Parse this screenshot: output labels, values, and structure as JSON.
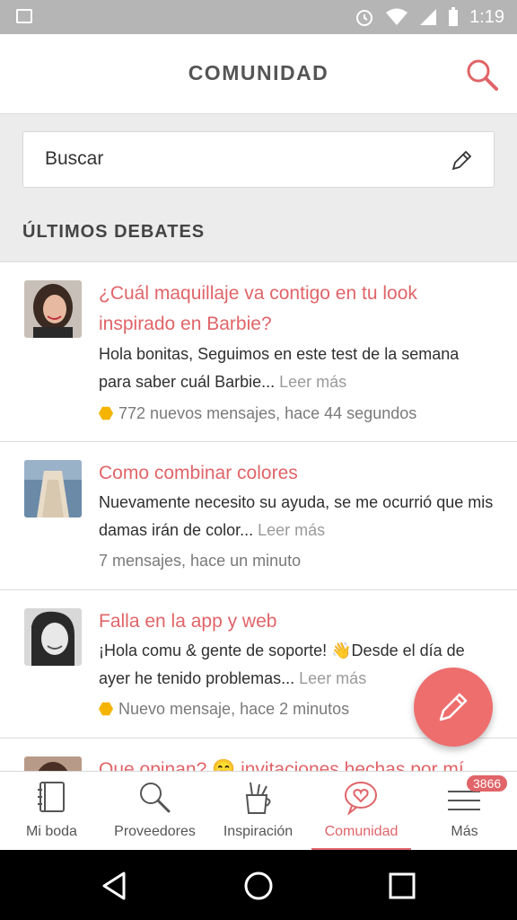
{
  "status_bar": {
    "time": "1:19"
  },
  "header": {
    "title": "COMUNIDAD"
  },
  "search": {
    "placeholder": "Buscar"
  },
  "section": {
    "title": "ÚLTIMOS DEBATES"
  },
  "debates": [
    {
      "title": "¿Cuál maquillaje va contigo en tu look inspirado en Barbie?",
      "excerpt": "Hola bonitas, Seguimos en este test de la semana para saber cuál Barbie...",
      "read_more": "Leer más",
      "meta": "772 nuevos mensajes, hace 44 segundos",
      "new_indicator": true
    },
    {
      "title": "Como combinar colores",
      "excerpt": "Nuevamente necesito su ayuda, se me ocurrió que mis damas irán de color...",
      "read_more": "Leer más",
      "meta": "7 mensajes, hace un minuto",
      "new_indicator": false
    },
    {
      "title": "Falla en la app y web",
      "excerpt": "¡Hola comu & gente de soporte! 👋Desde el día de ayer he tenido problemas...",
      "read_more": "Leer más",
      "meta": "Nuevo mensaje, hace 2 minutos",
      "new_indicator": true
    },
    {
      "title": "Que opinan? 😁 invitaciones hechas por mí"
    }
  ],
  "bottom_nav": [
    {
      "label": "Mi boda",
      "icon": "notebook-icon"
    },
    {
      "label": "Proveedores",
      "icon": "magnifier-icon"
    },
    {
      "label": "Inspiración",
      "icon": "brushes-cup-icon"
    },
    {
      "label": "Comunidad",
      "icon": "heart-chat-icon",
      "active": true
    },
    {
      "label": "Más",
      "icon": "menu-icon",
      "badge": "3866"
    }
  ],
  "colors": {
    "accent": "#e06468",
    "fab": "#ee6e6e",
    "new_indicator": "#f4b400"
  }
}
